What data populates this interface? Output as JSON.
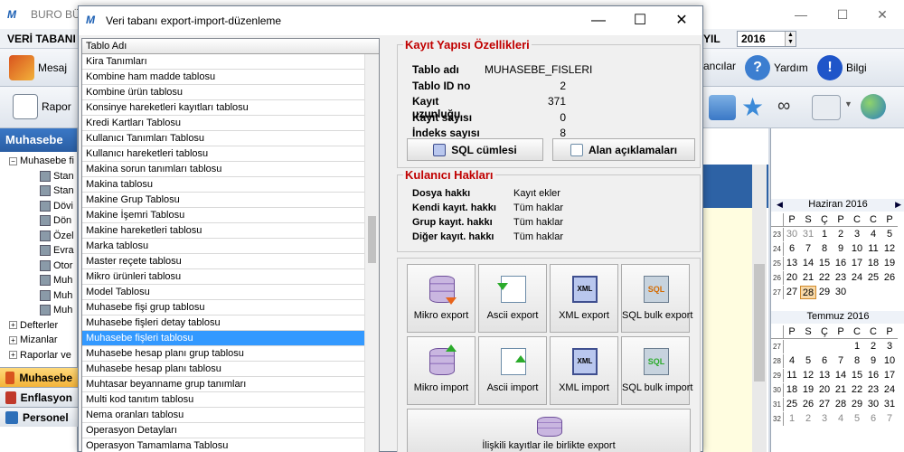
{
  "app": {
    "title": "BURO BÜR",
    "menu_first": "VERİ TABANI",
    "year_label": "YIL",
    "year_value": "2016",
    "toolbar1": {
      "message_label": "Mesaj",
      "users_label": "ancılar",
      "help_label": "Yardım",
      "info_label": "Bilgi"
    },
    "toolbar2": {
      "report_label": "Rapor"
    }
  },
  "sidebar": {
    "header": "Muhasebe",
    "tree": [
      {
        "label": "Muhasebe fi",
        "type": "group",
        "indent": 0
      },
      {
        "label": "Stan",
        "type": "leaf",
        "indent": 1
      },
      {
        "label": "Stan",
        "type": "leaf",
        "indent": 1
      },
      {
        "label": "Dövi",
        "type": "leaf",
        "indent": 1
      },
      {
        "label": "Dön",
        "type": "leaf",
        "indent": 1
      },
      {
        "label": "Özel",
        "type": "leaf",
        "indent": 1
      },
      {
        "label": "Evra",
        "type": "leaf",
        "indent": 1
      },
      {
        "label": "Otor",
        "type": "leaf",
        "indent": 1
      },
      {
        "label": "Muh",
        "type": "leaf",
        "indent": 1
      },
      {
        "label": "Muh",
        "type": "leaf",
        "indent": 1
      },
      {
        "label": "Muh",
        "type": "leaf",
        "indent": 1
      },
      {
        "label": "Defterler",
        "type": "group",
        "indent": 0
      },
      {
        "label": "Mizanlar",
        "type": "group",
        "indent": 0
      },
      {
        "label": "Raporlar ve",
        "type": "group",
        "indent": 0
      }
    ],
    "bottom": [
      {
        "label": "Muhasebe",
        "active": true,
        "color": "#d9541e"
      },
      {
        "label": "Enflasyon",
        "active": false,
        "color": "#c0392b"
      },
      {
        "label": "Personel",
        "active": false,
        "color": "#2e6fb8"
      }
    ]
  },
  "calendar": {
    "months": [
      {
        "title": "Haziran 2016",
        "headers": [
          "P",
          "S",
          "Ç",
          "P",
          "C",
          "C",
          "P"
        ],
        "weeks": [
          {
            "wk": "23",
            "days": [
              "30",
              "31",
              "1",
              "2",
              "3",
              "4",
              "5"
            ],
            "other": [
              true,
              true,
              false,
              false,
              false,
              false,
              false
            ]
          },
          {
            "wk": "24",
            "days": [
              "6",
              "7",
              "8",
              "9",
              "10",
              "11",
              "12"
            ],
            "other": [
              false,
              false,
              false,
              false,
              false,
              false,
              false
            ]
          },
          {
            "wk": "25",
            "days": [
              "13",
              "14",
              "15",
              "16",
              "17",
              "18",
              "19"
            ],
            "other": [
              false,
              false,
              false,
              false,
              false,
              false,
              false
            ]
          },
          {
            "wk": "26",
            "days": [
              "20",
              "21",
              "22",
              "23",
              "24",
              "25",
              "26"
            ],
            "other": [
              false,
              false,
              false,
              false,
              false,
              false,
              false
            ]
          },
          {
            "wk": "27",
            "days": [
              "27",
              "28",
              "29",
              "30",
              "",
              "",
              ""
            ],
            "other": [
              false,
              false,
              false,
              false,
              false,
              false,
              false
            ],
            "selected": 1
          }
        ]
      },
      {
        "title": "Temmuz 2016",
        "headers": [
          "P",
          "S",
          "Ç",
          "P",
          "C",
          "C",
          "P"
        ],
        "weeks": [
          {
            "wk": "27",
            "days": [
              "",
              "",
              "",
              "",
              "1",
              "2",
              "3"
            ],
            "other": [
              false,
              false,
              false,
              false,
              false,
              false,
              false
            ]
          },
          {
            "wk": "28",
            "days": [
              "4",
              "5",
              "6",
              "7",
              "8",
              "9",
              "10"
            ],
            "other": [
              false,
              false,
              false,
              false,
              false,
              false,
              false
            ]
          },
          {
            "wk": "29",
            "days": [
              "11",
              "12",
              "13",
              "14",
              "15",
              "16",
              "17"
            ],
            "other": [
              false,
              false,
              false,
              false,
              false,
              false,
              false
            ]
          },
          {
            "wk": "30",
            "days": [
              "18",
              "19",
              "20",
              "21",
              "22",
              "23",
              "24"
            ],
            "other": [
              false,
              false,
              false,
              false,
              false,
              false,
              false
            ]
          },
          {
            "wk": "31",
            "days": [
              "25",
              "26",
              "27",
              "28",
              "29",
              "30",
              "31"
            ],
            "other": [
              false,
              false,
              false,
              false,
              false,
              false,
              false
            ]
          },
          {
            "wk": "32",
            "days": [
              "1",
              "2",
              "3",
              "4",
              "5",
              "6",
              "7"
            ],
            "other": [
              true,
              true,
              true,
              true,
              true,
              true,
              true
            ]
          }
        ]
      }
    ]
  },
  "dialog": {
    "title": "Veri tabanı export-import-düzenleme",
    "table_header": "Tablo Adı",
    "tables": [
      "Kira Tanımları",
      "Kombine ham madde tablosu",
      "Kombine ürün tablosu",
      "Konsinye hareketleri kayıtları tablosu",
      "Kredi Kartları Tablosu",
      "Kullanıcı Tanımları Tablosu",
      "Kullanıcı hareketleri tablosu",
      "Makina sorun tanımları tablosu",
      "Makina tablosu",
      "Makine Grup Tablosu",
      "Makine İşemri Tablosu",
      "Makine hareketleri tablosu",
      "Marka tablosu",
      "Master reçete tablosu",
      "Mikro ürünleri tablosu",
      "Model Tablosu",
      "Muhasebe fişi grup tablosu",
      "Muhasebe fişleri detay tablosu",
      "Muhasebe fişleri tablosu",
      "Muhasebe hesap planı grup tablosu",
      "Muhasebe hesap planı tablosu",
      "Muhtasar beyanname grup tanımları",
      "Multi kod tanıtım tablosu",
      "Nema oranları tablosu",
      "Operasyon Detayları",
      "Operasyon Tamamlama Tablosu"
    ],
    "selected_index": 18,
    "props": {
      "caption": "Kayıt Yapısı Özellikleri",
      "rows": [
        {
          "k": "Tablo adı",
          "v": "MUHASEBE_FISLERI",
          "align": "left"
        },
        {
          "k": "Tablo ID no",
          "v": "2",
          "align": "right"
        },
        {
          "k": "Kayıt uzunluğu",
          "v": "371",
          "align": "right"
        },
        {
          "k": "Kayıt sayısı",
          "v": "0",
          "align": "right"
        },
        {
          "k": "İndeks sayısı",
          "v": "8",
          "align": "right"
        }
      ],
      "sql_button": "SQL cümlesi",
      "fields_button": "Alan açıklamaları"
    },
    "rights": {
      "caption": "Kulanıcı Hakları",
      "rows": [
        {
          "k": "Dosya hakkı",
          "v": "Kayıt ekler"
        },
        {
          "k": "Kendi kayıt. hakkı",
          "v": "Tüm haklar"
        },
        {
          "k": "Grup kayıt. hakkı",
          "v": "Tüm haklar"
        },
        {
          "k": "Diğer kayıt. hakkı",
          "v": "Tüm haklar"
        }
      ]
    },
    "actions": {
      "mikro_export": "Mikro export",
      "ascii_export": "Ascii export",
      "xml_export": "XML export",
      "sql_bulk_export": "SQL bulk export",
      "mikro_import": "Mikro import",
      "ascii_import": "Ascii import",
      "xml_import": "XML import",
      "sql_bulk_import": "SQL bulk import",
      "related_export": "İlişkili kayıtlar ile birlikte export",
      "xml_icon_text": "XML",
      "sql_icon_text": "SQL"
    }
  }
}
